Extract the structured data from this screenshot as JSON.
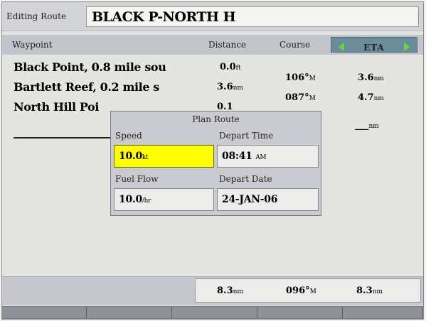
{
  "header": {
    "title_label": "Editing Route",
    "route_name": "BLACK P-NORTH H"
  },
  "columns": {
    "waypoint": "Waypoint",
    "distance": "Distance",
    "course": "Course",
    "eta": "ETA"
  },
  "waypoints": [
    {
      "name": "Black Point, 0.8 mile sou",
      "distance": "0.0",
      "distance_unit": "ft"
    },
    {
      "name": "Bartlett Reef, 0.2 mile s",
      "distance": "3.6",
      "distance_unit": "nm"
    },
    {
      "name": "North Hill Poi",
      "distance": "0.1",
      "distance_unit": ""
    }
  ],
  "legs": [
    {
      "course": "106°",
      "course_unit": "M",
      "eta": "3.6",
      "eta_unit": "nm"
    },
    {
      "course": "087°",
      "course_unit": "M",
      "eta": "4.7",
      "eta_unit": "nm"
    }
  ],
  "empty_row": {
    "eta_placeholder": "___",
    "eta_unit": "nm"
  },
  "dialog": {
    "title": "Plan Route",
    "speed_label": "Speed",
    "speed_value": "10.0",
    "speed_unit": "kt",
    "depart_time_label": "Depart Time",
    "depart_time_value": "08:41",
    "depart_time_suffix": "AM",
    "fuel_flow_label": "Fuel Flow",
    "fuel_flow_value": "10.0",
    "fuel_flow_unit": "/hr",
    "depart_date_label": "Depart Date",
    "depart_date_value": "24-JAN-06"
  },
  "totals": {
    "distance": "8.3",
    "distance_unit": "nm",
    "course": "096°",
    "course_unit": "M",
    "eta": "8.3",
    "eta_unit": "nm"
  },
  "colors": {
    "active_field": "#ffff00",
    "selector_bg": "#6d8c9a",
    "selector_arrow": "#5edb3a"
  }
}
